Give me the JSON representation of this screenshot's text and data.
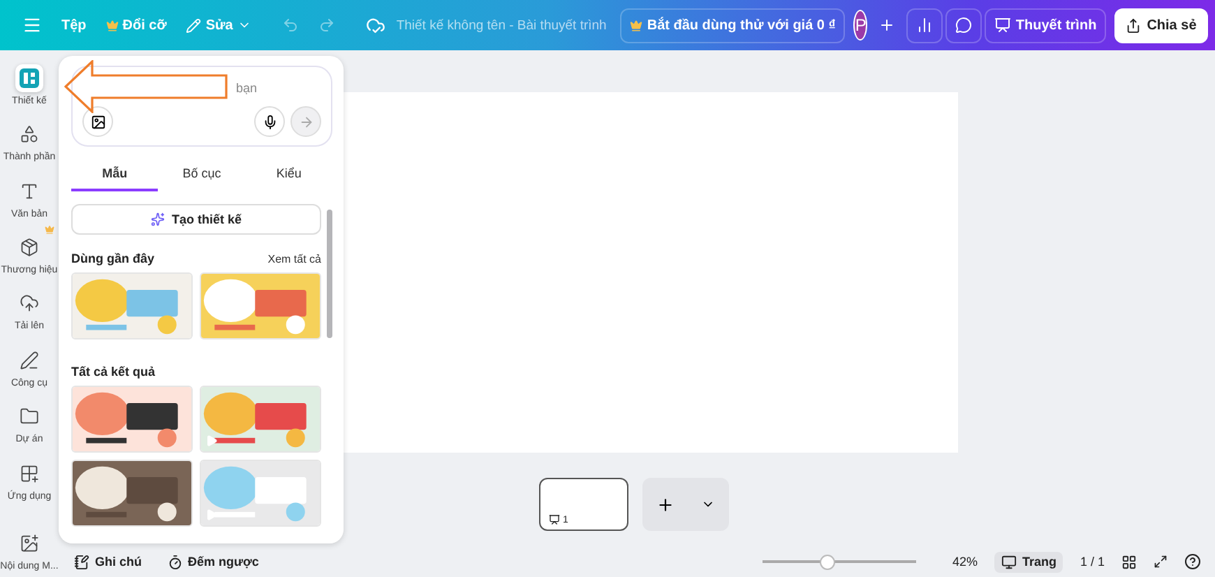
{
  "topbar": {
    "file": "Tệp",
    "resize": "Đổi cỡ",
    "edit": "Sửa",
    "history": [
      {
        "kind": "undo",
        "disabled": true
      },
      {
        "kind": "redo",
        "disabled": true
      }
    ],
    "title": "Thiết kế không tên - Bài thuyết trình",
    "trial": "Bắt đầu dùng thử với giá 0 ₫",
    "avatar": "P",
    "present": "Thuyết trình",
    "share": "Chia sẻ"
  },
  "rail": [
    {
      "kind": "design",
      "label": "Thiết kế",
      "selected": true,
      "premium": false
    },
    {
      "kind": "elements",
      "label": "Thành phần",
      "selected": false,
      "premium": false
    },
    {
      "kind": "text",
      "label": "Văn bản",
      "selected": false,
      "premium": false
    },
    {
      "kind": "brand",
      "label": "Thương hiệu",
      "selected": false,
      "premium": true
    },
    {
      "kind": "uploads",
      "label": "Tải lên",
      "selected": false,
      "premium": false
    },
    {
      "kind": "tools",
      "label": "Công cụ",
      "selected": false,
      "premium": false
    },
    {
      "kind": "projects",
      "label": "Dự án",
      "selected": false,
      "premium": false
    },
    {
      "kind": "apps",
      "label": "Ứng dụng",
      "selected": false,
      "premium": false
    },
    {
      "kind": "media",
      "label": "Nội dung M...",
      "selected": false,
      "premium": false
    }
  ],
  "panel": {
    "prompt_tail": "bạn",
    "tabs": [
      {
        "label": "Mẫu",
        "selected": true
      },
      {
        "label": "Bố cục",
        "selected": false
      },
      {
        "label": "Kiểu",
        "selected": false
      }
    ],
    "create": "Tạo thiết kế",
    "recent": {
      "title": "Dùng gần đây",
      "see_all": "Xem tất cả",
      "items": [
        {
          "kind": "picture",
          "video": false
        },
        {
          "kind": "picture",
          "video": false
        }
      ]
    },
    "results": {
      "title": "Tất cả kết quả",
      "items": [
        {
          "kind": "picture",
          "video": false
        },
        {
          "kind": "picture",
          "video": true
        },
        {
          "kind": "picture",
          "video": false
        },
        {
          "kind": "picture",
          "video": true
        }
      ]
    }
  },
  "pages": {
    "thumb_label": "1"
  },
  "status": {
    "notes": "Ghi chú",
    "timer": "Đếm ngược",
    "zoom": {
      "level": 0.41,
      "reading": "42%"
    },
    "view": "Trang",
    "count": "1 / 1"
  }
}
